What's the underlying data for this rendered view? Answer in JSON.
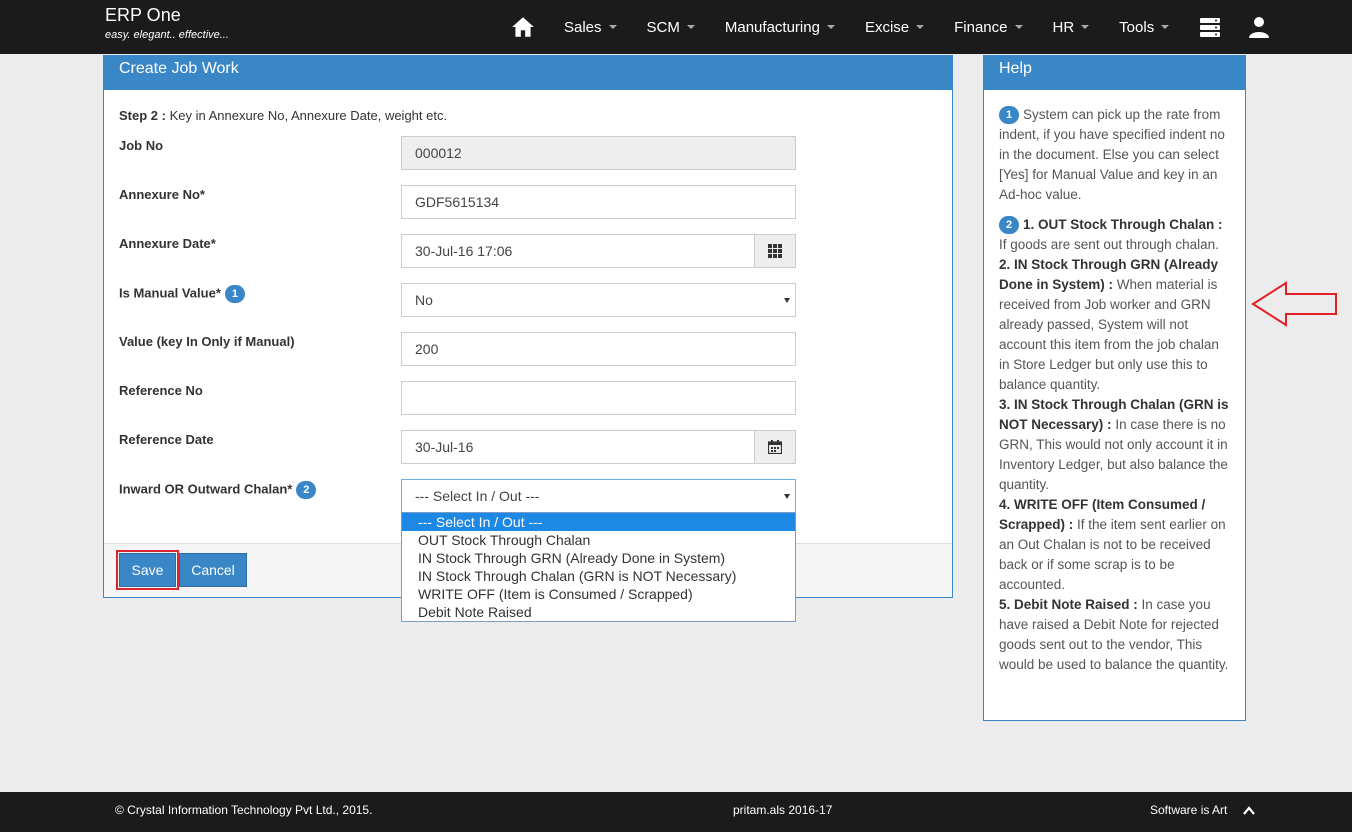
{
  "brand": {
    "title": "ERP One",
    "tagline": "easy. elegant.. effective..."
  },
  "nav": {
    "items": [
      "Sales",
      "SCM",
      "Manufacturing",
      "Excise",
      "Finance",
      "HR",
      "Tools"
    ]
  },
  "panel": {
    "title": "Create Job Work",
    "step_bold": "Step 2 :",
    "step_text": " Key in Annexure No, Annexure Date, weight etc.",
    "fields": {
      "job_no": {
        "label": "Job No",
        "value": "000012"
      },
      "annexure_no": {
        "label": "Annexure No*",
        "value": "GDF5615134"
      },
      "annexure_date": {
        "label": "Annexure Date*",
        "value": "30-Jul-16 17:06"
      },
      "manual_value": {
        "label": "Is Manual Value*",
        "badge": "1",
        "value": "No"
      },
      "value": {
        "label": "Value (key In Only if Manual)",
        "value": "200"
      },
      "reference_no": {
        "label": "Reference No",
        "value": ""
      },
      "reference_date": {
        "label": "Reference Date",
        "value": "30-Jul-16"
      },
      "chalan": {
        "label": "Inward OR Outward Chalan*",
        "badge": "2",
        "value": "--- Select In / Out ---"
      }
    },
    "save_label": "Save",
    "cancel_label": "Cancel"
  },
  "dropdown": {
    "options": [
      "--- Select In / Out ---",
      "OUT Stock Through Chalan",
      "IN Stock Through GRN (Already Done in System)",
      "IN Stock Through Chalan (GRN is NOT Necessary)",
      "WRITE OFF (Item is Consumed / Scrapped)",
      "Debit Note Raised"
    ]
  },
  "help": {
    "title": "Help",
    "p1_badge": "1",
    "p1_text": "System can pick up the rate from indent, if you have specified indent no in the document. Else you can select [Yes] for Manual Value and key in an Ad-hoc value.",
    "p2_badge": "2",
    "items": [
      {
        "bold": "1. OUT Stock Through Chalan :",
        "text": " If goods are sent out through chalan."
      },
      {
        "bold": "2. IN Stock Through GRN (Already Done in System) :",
        "text": " When material is received from Job worker and GRN already passed, System will not account this item from the job chalan in Store Ledger but only use this to balance quantity."
      },
      {
        "bold": "3. IN Stock Through Chalan (GRN is NOT Necessary) :",
        "text": " In case there is no GRN, This would not only account it in Inventory Ledger, but also balance the quantity."
      },
      {
        "bold": "4. WRITE OFF (Item Consumed / Scrapped) :",
        "text": " If the item sent earlier on an Out Chalan is not to be received back or if some scrap is to be accounted."
      },
      {
        "bold": "5. Debit Note Raised :",
        "text": " In case you have raised a Debit Note for rejected goods sent out to the vendor, This would be used to balance the quantity."
      }
    ]
  },
  "footer": {
    "copyright": "© Crystal Information Technology Pvt Ltd., 2015.",
    "user": "pritam.als 2016-17",
    "tagline": "Software is Art"
  }
}
